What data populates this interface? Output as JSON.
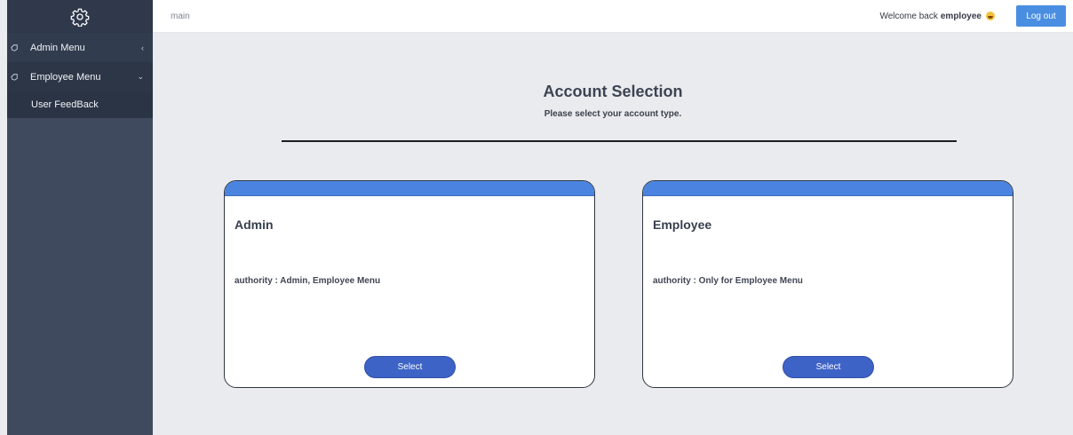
{
  "sidebar": {
    "logo_icon": "gear-icon",
    "menus": [
      {
        "label": "Admin Menu",
        "icon": "hand-icon",
        "arrow": "‹"
      },
      {
        "label": "Employee Menu",
        "icon": "hand-icon",
        "arrow": "⌄",
        "items": [
          {
            "label": "User FeedBack"
          }
        ]
      }
    ]
  },
  "header": {
    "breadcrumb": "main",
    "welcome_prefix": "Welcome back",
    "username": "employee",
    "logout_label": "Log out"
  },
  "main": {
    "title": "Account Selection",
    "subtitle": "Please select your account type.",
    "cards": [
      {
        "title": "Admin",
        "authority": "authority : Admin, Employee Menu",
        "button": "Select"
      },
      {
        "title": "Employee",
        "authority": "authority : Only for Employee Menu",
        "button": "Select"
      }
    ]
  },
  "colors": {
    "sidebar_bg": "#3f4a5f",
    "accent_blue": "#4a84e0",
    "select_button": "#3e63c7",
    "logout_button": "#4a8ee2",
    "page_bg": "#eaebee"
  }
}
